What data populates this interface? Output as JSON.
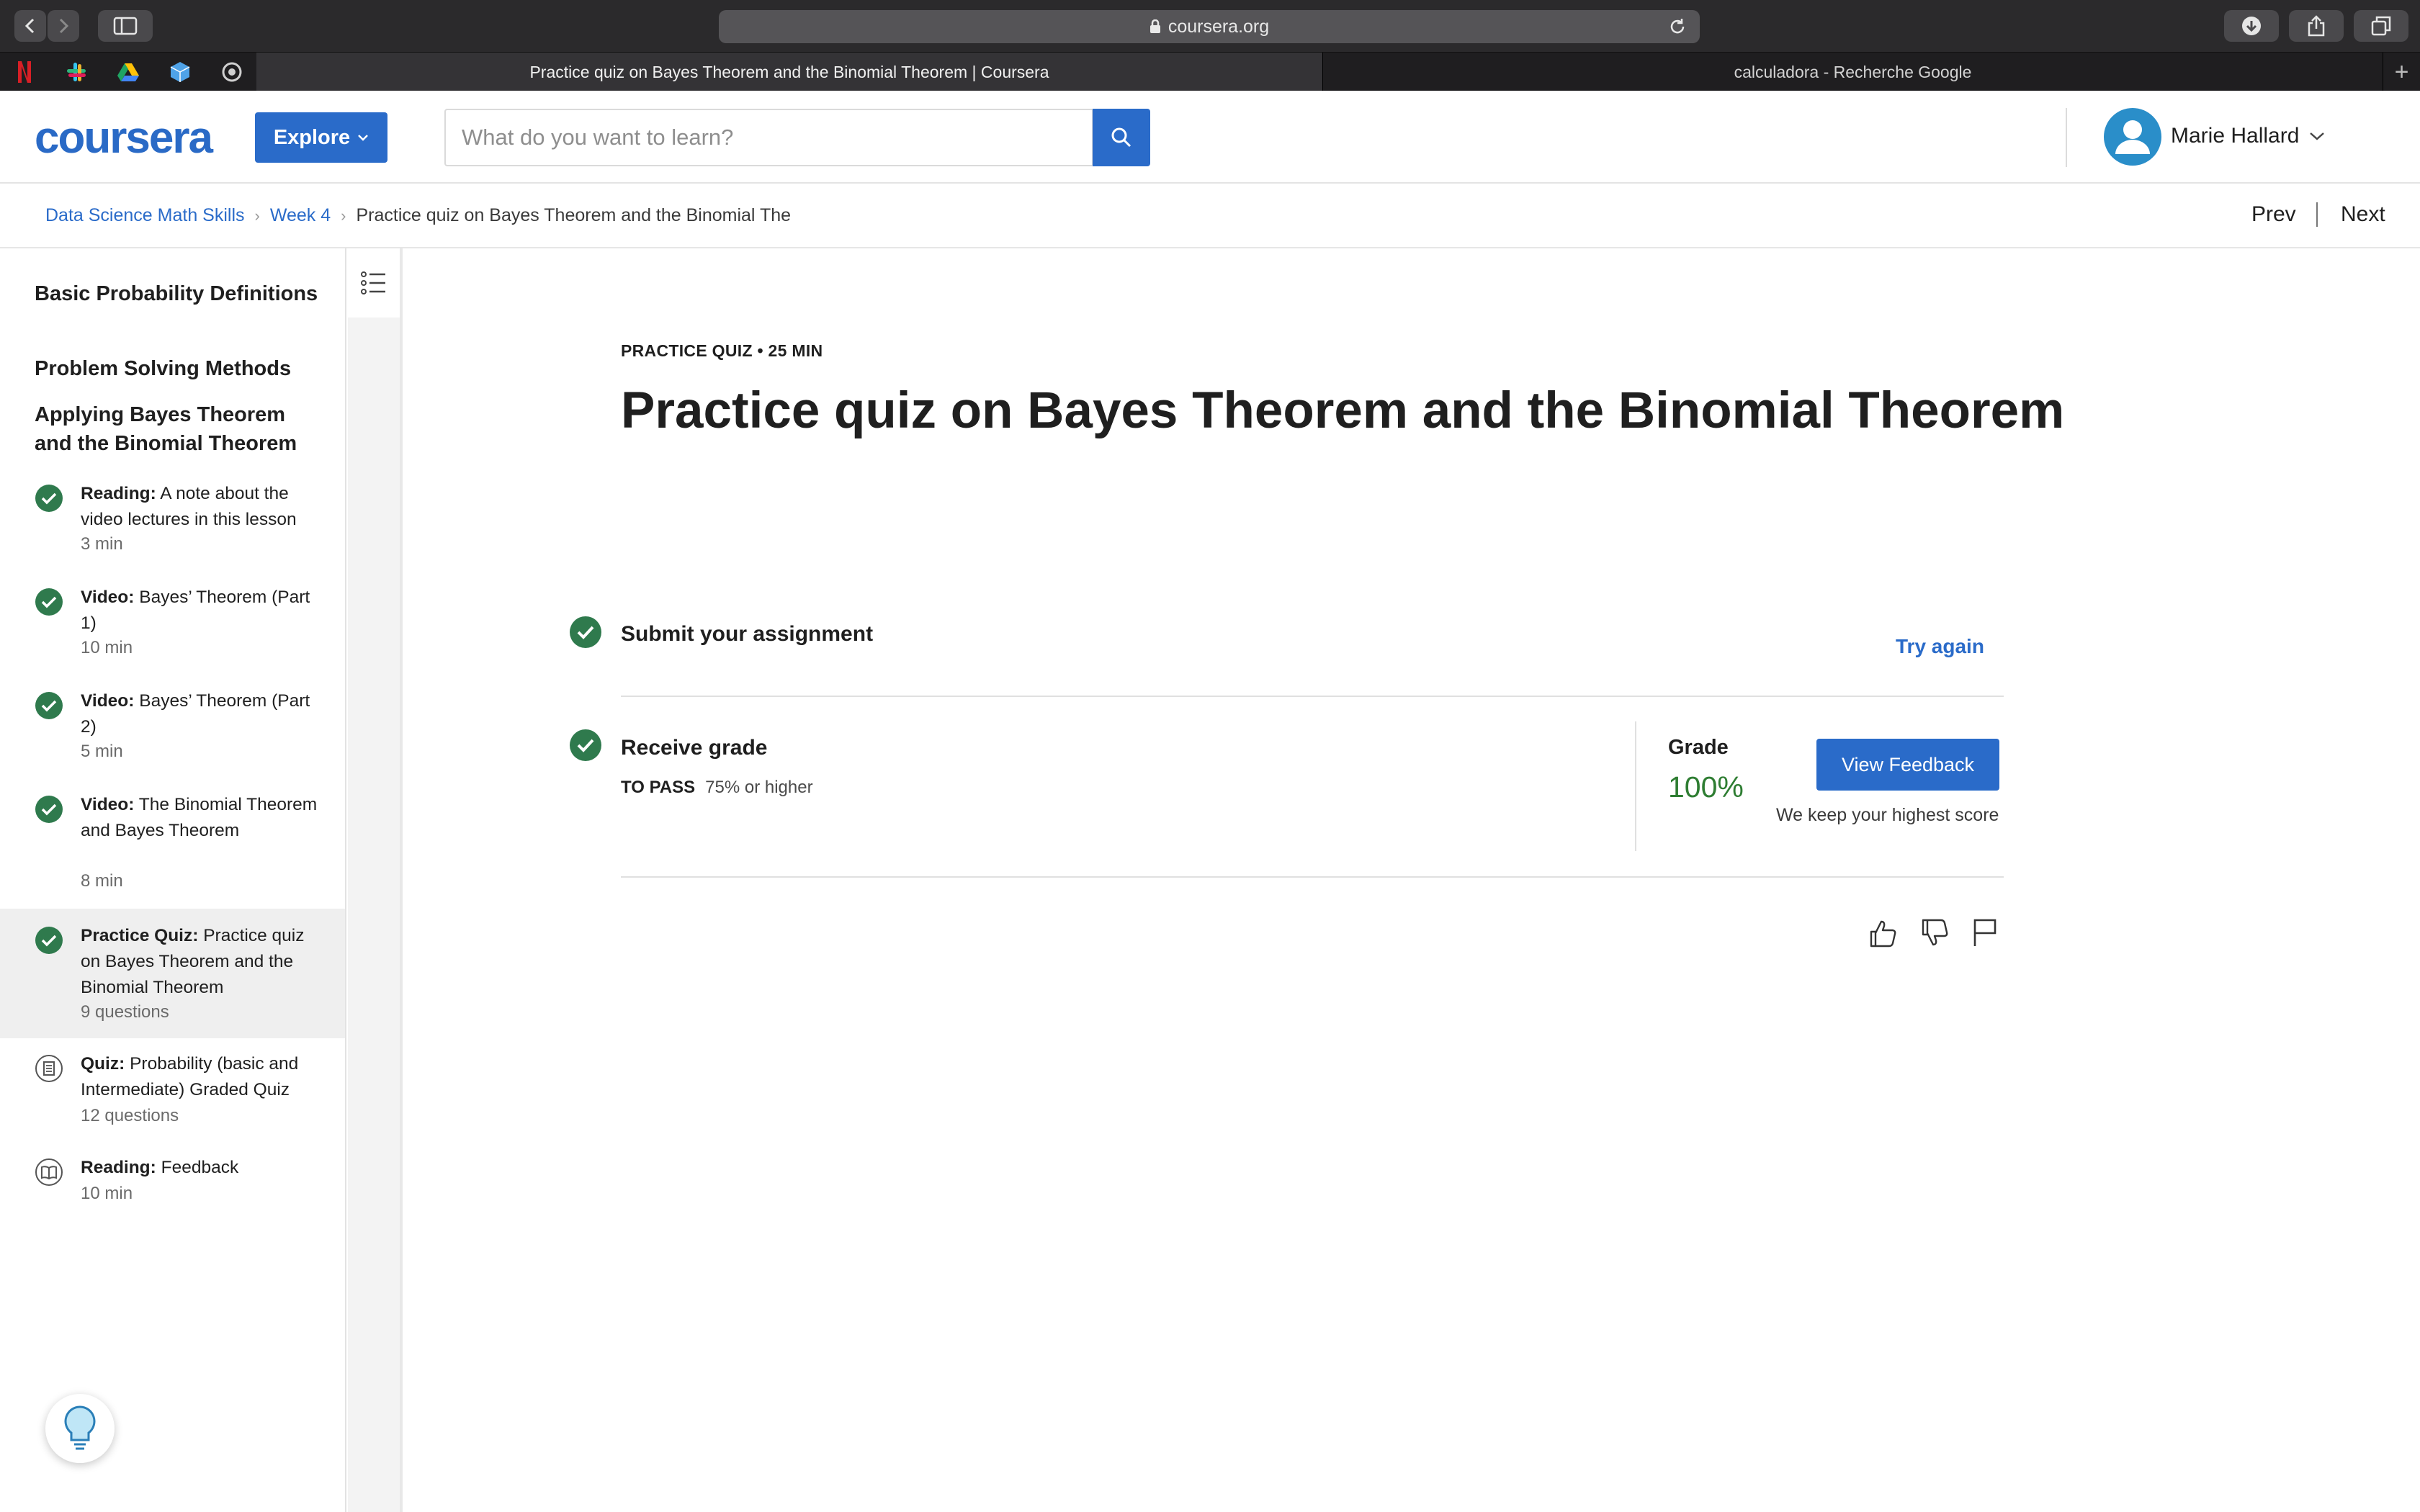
{
  "browser": {
    "url": "coursera.org",
    "tabs": [
      {
        "title": "Practice quiz on Bayes Theorem and the Binomial Theorem | Coursera",
        "active": true
      },
      {
        "title": "calculadora - Recherche Google",
        "active": false
      }
    ],
    "bookmarks": [
      "netflix-icon",
      "slack-icon",
      "google-drive-icon",
      "cube-icon",
      "sync-icon"
    ]
  },
  "header": {
    "logo": "coursera",
    "explore_label": "Explore",
    "search_placeholder": "What do you want to learn?",
    "user_name": "Marie Hallard",
    "accent": "#2a6bc9"
  },
  "breadcrumb": {
    "items": [
      "Data Science Math Skills",
      "Week 4"
    ],
    "current": "Practice quiz on Bayes Theorem and the Binomial The",
    "prev": "Prev",
    "next": "Next"
  },
  "sidebar": {
    "sections": [
      "Basic Probability Definitions",
      "Problem Solving Methods",
      "Applying Bayes Theorem and the Binomial Theorem"
    ],
    "items": [
      {
        "type": "Reading:",
        "title": "A note about the video lectures in this lesson",
        "meta": "3 min",
        "status": "completed"
      },
      {
        "type": "Video:",
        "title": "Bayes’ Theorem (Part 1)",
        "meta": "10 min",
        "status": "completed"
      },
      {
        "type": "Video:",
        "title": "Bayes’ Theorem (Part 2)",
        "meta": "5 min",
        "status": "completed"
      },
      {
        "type": "Video:",
        "title": "The Binomial Theorem and Bayes Theorem",
        "meta": "8 min",
        "status": "completed"
      },
      {
        "type": "Practice Quiz:",
        "title": "Practice quiz on Bayes Theorem and the Binomial Theorem",
        "meta": "9 questions",
        "status": "completed-active"
      },
      {
        "type": "Quiz:",
        "title": "Probability (basic and Intermediate) Graded Quiz",
        "meta": "12 questions",
        "status": "quiz"
      },
      {
        "type": "Reading:",
        "title": "Feedback",
        "meta": "10 min",
        "status": "reading"
      }
    ]
  },
  "main": {
    "eyebrow": "PRACTICE QUIZ • 25 MIN",
    "title": "Practice quiz on Bayes Theorem and the Binomial Theorem",
    "step1_label": "Submit your assignment",
    "try_again": "Try again",
    "step2_label": "Receive grade",
    "to_pass_label": "TO PASS",
    "to_pass_value": "75% or higher",
    "grade_label": "Grade",
    "grade_value": "100%",
    "grade_fraction": 1.0,
    "view_feedback": "View Feedback",
    "keep_note": "We keep your highest score",
    "success_color": "#2e7d32"
  }
}
